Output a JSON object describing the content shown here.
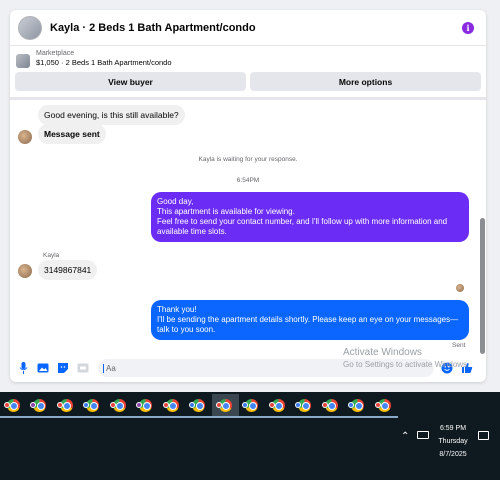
{
  "chat": {
    "title": "Kayla · 2 Beds 1 Bath Apartment/condo",
    "listing_label": "Marketplace",
    "listing_price": "$1,050 · 2 Beds 1 Bath Apartment/condo",
    "view_buyer": "View buyer",
    "more_options": "More options",
    "info_glyph": "i"
  },
  "messages": {
    "in1": "Good evening, is this still available?",
    "in2": "Message sent",
    "waiting": "Kayla is waiting for your response.",
    "time": "6:54PM",
    "out1": [
      "Good day,",
      "This apartment is available for viewing.",
      "Feel free to send your contact number, and I'll follow up with more information and",
      "available time slots."
    ],
    "sender_name": "Kayla",
    "in3": "3149867841",
    "out2": [
      "Thank you!",
      "I'll be sending the apartment details shortly. Please keep an eye on your messages—",
      "talk to you soon."
    ],
    "sent_label": "Sent",
    "colors": {
      "out1": "#6b2cf5",
      "out2": "#0a66ff"
    }
  },
  "composer": {
    "placeholder": "Aa"
  },
  "watermark": {
    "title": "Activate Windows",
    "subtitle": "Go to Settings to activate Windows."
  },
  "taskbar": {
    "time": "6:59 PM",
    "day": "Thursday",
    "date": "8/7/2025",
    "badge_colors": [
      "#e8453c",
      "#8e44ad",
      "#e8453c",
      "#3c7be8",
      "#e8453c",
      "#8e44ad",
      "#e8453c",
      "#3c7be8",
      "#e8453c",
      "#3c7be8",
      "#e8453c",
      "#3c7be8",
      "#e8453c",
      "#3c7be8",
      "#e8453c"
    ]
  }
}
